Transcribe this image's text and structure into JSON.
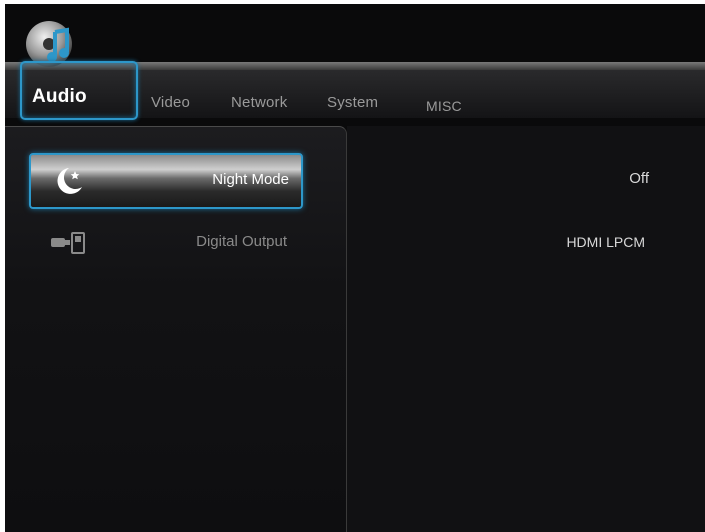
{
  "tabs": [
    {
      "label": "Audio"
    },
    {
      "label": "Video"
    },
    {
      "label": "Network"
    },
    {
      "label": "System"
    },
    {
      "label": "MISC"
    }
  ],
  "settings": [
    {
      "label": "Night Mode",
      "value": "Off",
      "icon": "moon-star-icon"
    },
    {
      "label": "Digital Output",
      "value": "HDMI LPCM",
      "icon": "digital-output-icon"
    }
  ],
  "colors": {
    "accent": "#2d97c9",
    "background": "#0a0a0b"
  }
}
